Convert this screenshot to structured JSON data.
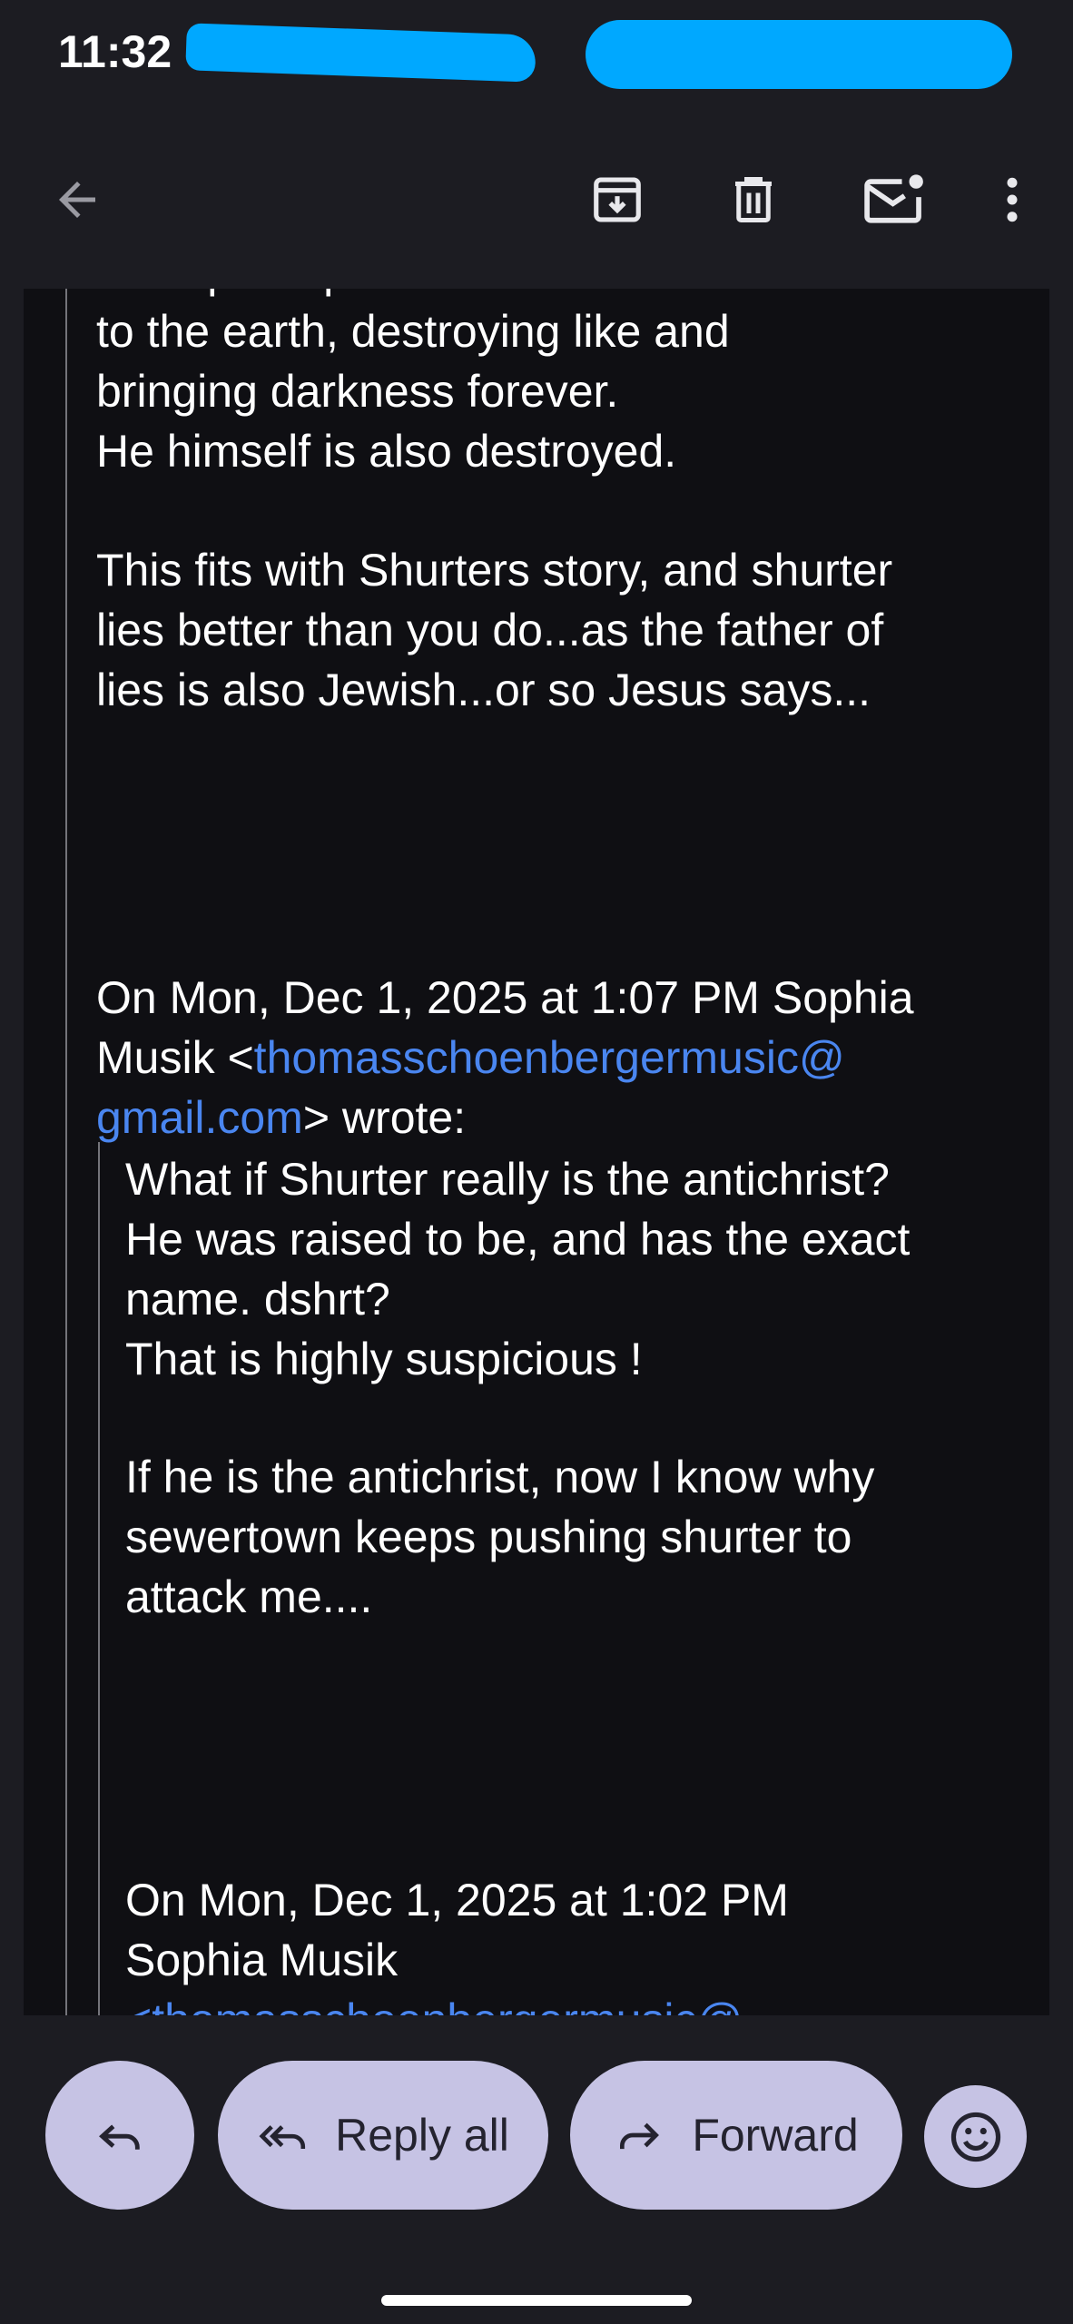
{
  "status_bar": {
    "time": "11:32"
  },
  "app_bar": {
    "icons": [
      "back-arrow-icon",
      "archive-icon",
      "trash-icon",
      "mark-unread-icon",
      "more-vert-icon"
    ]
  },
  "message": {
    "partial_top_line": "fireexperhaps because he drove the sun",
    "paragraph_1": "to the earth, destroying like and\nbringing darkness forever.\nHe himself is also destroyed.",
    "paragraph_2": "This fits with Shurters story, and shurter\nlies better than you do...as the father of\nlies is also Jewish...or so Jesus says...",
    "quote_header_1": {
      "prefix": "On Mon, Dec 1, 2025 at 1:07 PM Sophia\nMusik <",
      "email_part_1": "thomasschoenbergermusic@",
      "email_part_2": "gmail.com",
      "suffix": "> wrote:"
    },
    "quoted_paragraph_1": "What if Shurter really is the antichrist?\nHe was raised to be, and has the exact\nname. dshrt?\nThat is highly suspicious !",
    "quoted_paragraph_2": "If he is the antichrist, now I know why\nsewertown keeps pushing shurter to\nattack me....",
    "quote_header_2": "On Mon, Dec 1, 2025 at 1:02 PM\nSophia Musik",
    "partial_bottom_link": "<thomasschoenbergermusic@"
  },
  "actions": {
    "reply_all_label": "Reply all",
    "forward_label": "Forward"
  },
  "colors": {
    "background": "#1c1c22",
    "message_background": "#0f0f13",
    "link": "#4a86f0",
    "pill": "#c6c3e4",
    "redaction": "#00a8ff"
  }
}
